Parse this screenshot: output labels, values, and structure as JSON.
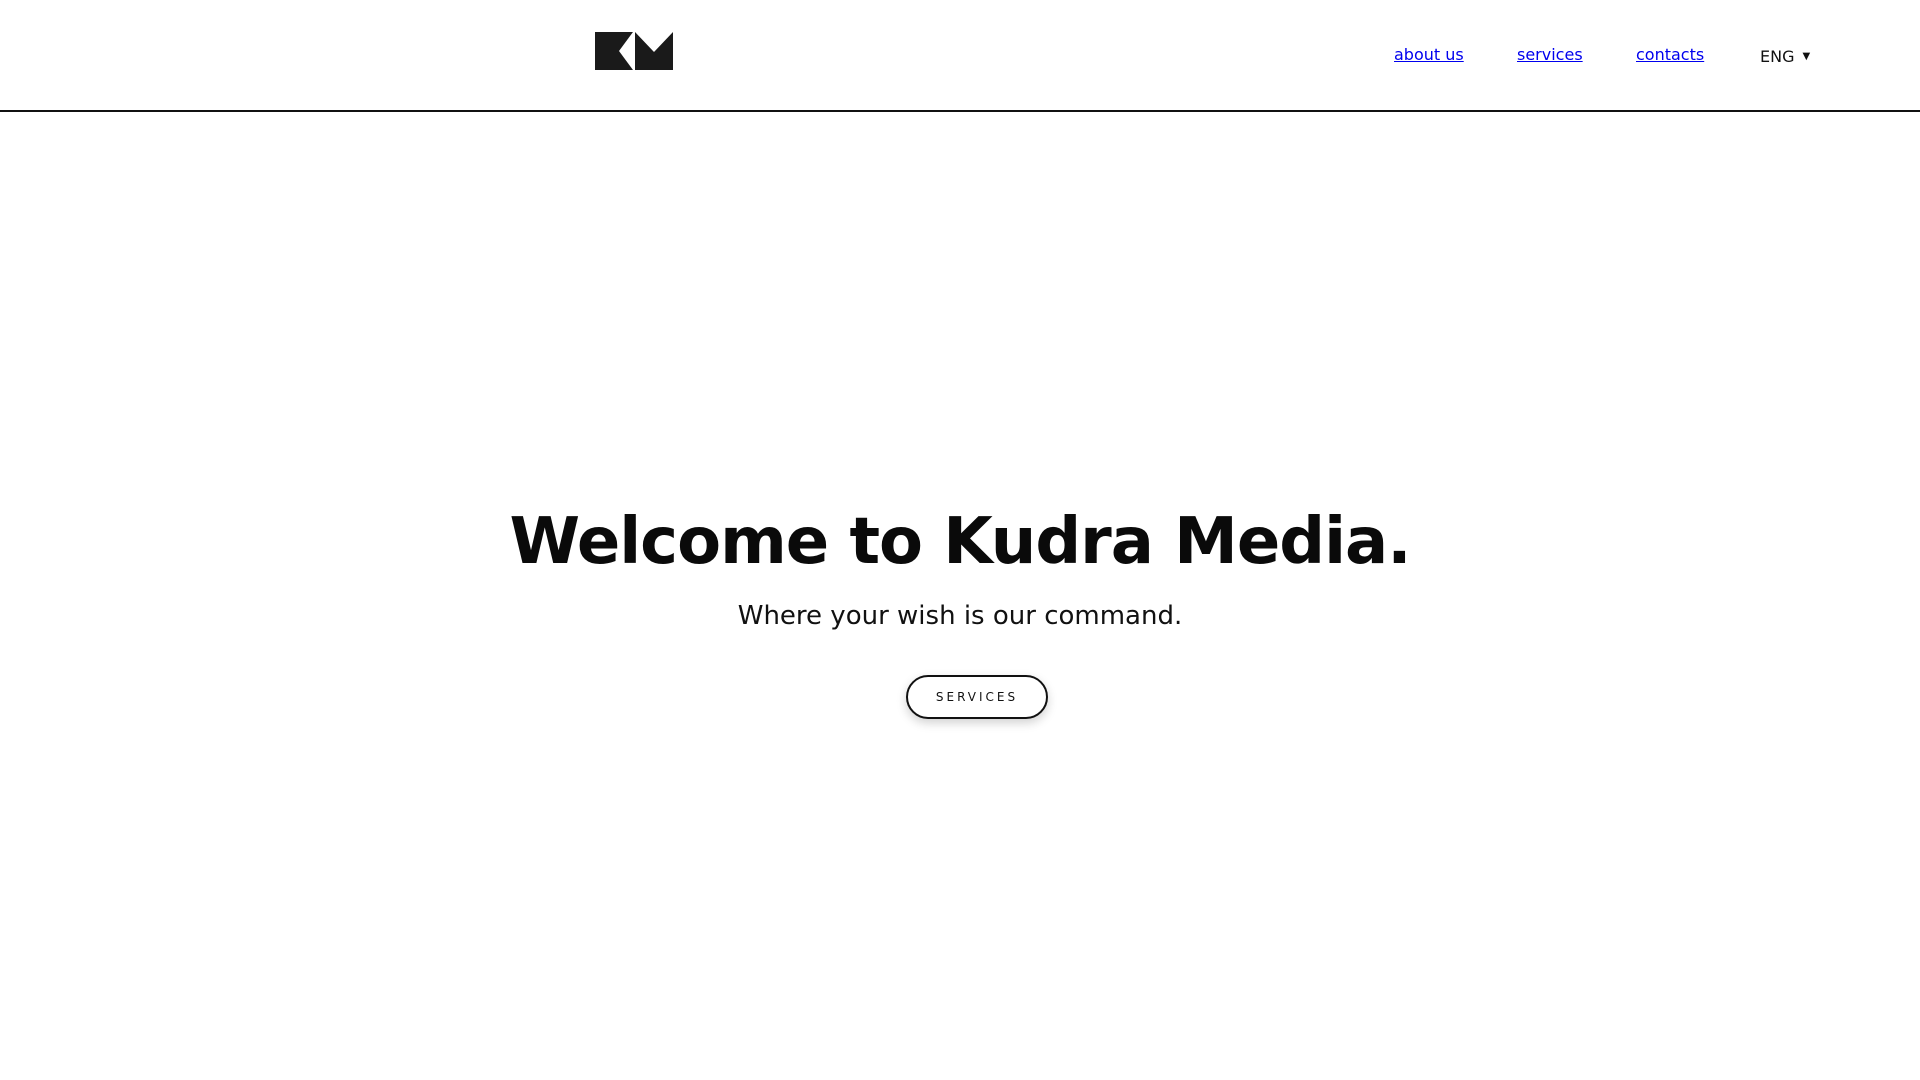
{
  "header": {
    "logo_icon": "km-logo-icon",
    "nav": [
      {
        "label": "about us"
      },
      {
        "label": "services"
      },
      {
        "label": "contacts"
      }
    ],
    "language": {
      "selected": "ENG",
      "icon": "caret-down-icon"
    }
  },
  "hero": {
    "title": "Welcome to Kudra Media.",
    "subtitle": "Where your wish is our command.",
    "cta_label": "SERVICES"
  },
  "colors": {
    "text": "#111111",
    "background": "#ffffff"
  }
}
